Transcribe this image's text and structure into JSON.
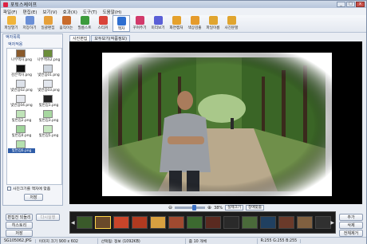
{
  "window": {
    "title": "포토스케이프",
    "controls": [
      "_",
      "□",
      "x"
    ]
  },
  "menu": [
    "파일(F)",
    "편집(E)",
    "보기(V)",
    "효과(X)",
    "도구(T)",
    "도움말(H)"
  ],
  "toolbar": [
    {
      "label": "파일열기",
      "icon": "folder-open-icon",
      "color": "#f0b43a"
    },
    {
      "label": "저장하기",
      "icon": "save-icon",
      "color": "#6a8fd6"
    },
    {
      "label": "일괄편집",
      "icon": "batch-edit-icon",
      "color": "#e6a03a"
    },
    {
      "label": "움직이는",
      "icon": "animation-icon",
      "color": "#c96b2b"
    },
    {
      "label": "필름스트",
      "icon": "filmstrip-icon",
      "color": "#3c9b3c"
    },
    {
      "label": "스티커",
      "icon": "sticker-icon",
      "color": "#d9433a"
    },
    {
      "label": "액자",
      "icon": "frame-icon",
      "color": "#2f6fd0"
    },
    {
      "label": "꾸며주기",
      "icon": "decorate-icon",
      "color": "#d23a6b"
    },
    {
      "label": "미리보기",
      "icon": "preview-icon",
      "color": "#5a5fd6"
    },
    {
      "label": "화면캡처",
      "icon": "capture-icon",
      "color": "#e5a12c"
    },
    {
      "label": "색상검출",
      "icon": "color-picker-icon",
      "color": "#e59b2c"
    },
    {
      "label": "파일이름",
      "icon": "rename-icon",
      "color": "#e0a52f"
    },
    {
      "label": "사진분할",
      "icon": "split-icon",
      "color": "#e0a52f"
    }
  ],
  "sidebar": {
    "header": "액자목록",
    "subheader": "액자적용",
    "frames": [
      {
        "caption": "나무액자.png",
        "color": "#8a5a2b"
      },
      {
        "caption": "나무액자2.png",
        "color": "#6b8e3a"
      },
      {
        "caption": "검은액자.png",
        "color": "#111111"
      },
      {
        "caption": "빛번짐01.png",
        "color": "#cfd6df"
      },
      {
        "caption": "빛번짐02.png",
        "color": "#dde2ea"
      },
      {
        "caption": "빛번짐03.png",
        "color": "#e3e7ee"
      },
      {
        "caption": "빛번짐04.png",
        "color": "#e5e8ee"
      },
      {
        "caption": "빛번짐1.png",
        "color": "#222222"
      },
      {
        "caption": "빛번짐2.png",
        "color": "#bfe3b8"
      },
      {
        "caption": "빛번짐3.png",
        "color": "#a7d7a0"
      },
      {
        "caption": "빛번짐4.png",
        "color": "#9fd49a"
      },
      {
        "caption": "빛번짐5.png",
        "color": "#c7e9c0"
      },
      {
        "caption": "빛번짐6.png",
        "color": "#b5e0ae",
        "selected": true
      }
    ],
    "checkbox_label": "사진크기를 액자에 맞춤",
    "save_button": "저장"
  },
  "left_buttons": {
    "undo": "편집전 되돌리기",
    "redo": "다시실행",
    "history": "히스토리",
    "save": "저장"
  },
  "tabs": [
    "사진편집",
    "모두보기(작품정보)"
  ],
  "zoom": {
    "value": "38%",
    "actual_size": "실제크기",
    "fit_window": "창에맞춤"
  },
  "filmstrip": {
    "thumbnails": [
      "#3a5a2a",
      "#6a4a2a",
      "#c8452a",
      "#b03a20",
      "#d8a040",
      "#a04a30",
      "#3c6a30",
      "#5a2a20",
      "#2a2a2a",
      "#4a6a3a",
      "#204060",
      "#6a3a2a",
      "#806040",
      "#303030"
    ],
    "current_index": 1
  },
  "right_buttons": {
    "add": "추가",
    "delete": "삭제",
    "delete_all": "전체제거"
  },
  "status": [
    "SG105062.JPG",
    "이미지 크기 900 x 602",
    "선택됨: 정보 (1092KB)",
    "줌 10 개체",
    "R:255 G:255 B:255"
  ]
}
